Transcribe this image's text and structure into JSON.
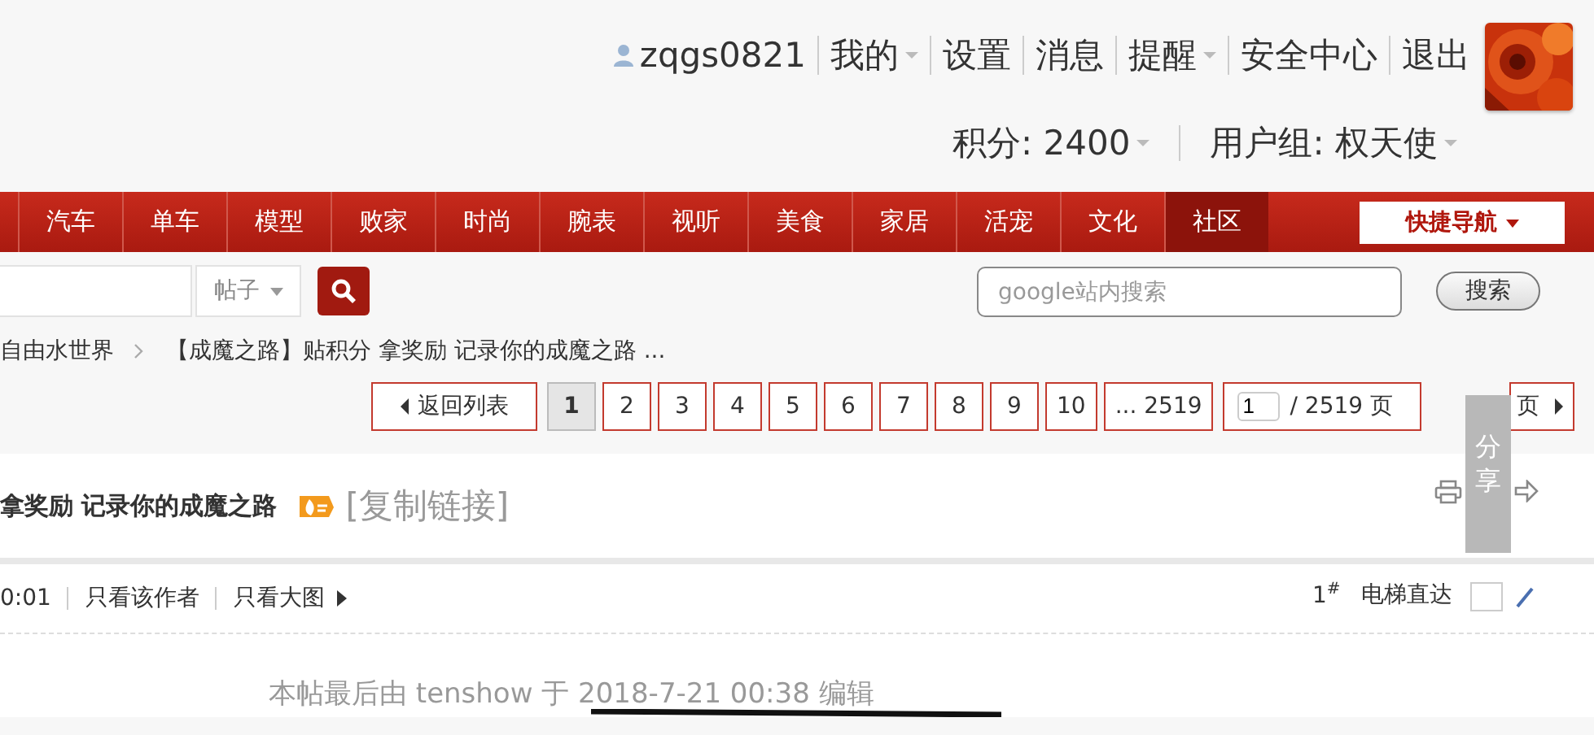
{
  "user_bar": {
    "username": "zqgs0821",
    "links": [
      {
        "label": "我的",
        "dropdown": true
      },
      {
        "label": "设置",
        "dropdown": false
      },
      {
        "label": "消息",
        "dropdown": false
      },
      {
        "label": "提醒",
        "dropdown": true
      },
      {
        "label": "安全中心",
        "dropdown": false
      },
      {
        "label": "退出",
        "dropdown": false
      }
    ],
    "points": "积分: 2400",
    "user_group": "用户组: 权天使"
  },
  "nav": {
    "items": [
      {
        "label": "汽车",
        "selected": false
      },
      {
        "label": "单车",
        "selected": false
      },
      {
        "label": "模型",
        "selected": false
      },
      {
        "label": "败家",
        "selected": false
      },
      {
        "label": "时尚",
        "selected": false
      },
      {
        "label": "腕表",
        "selected": false
      },
      {
        "label": "视听",
        "selected": false
      },
      {
        "label": "美食",
        "selected": false
      },
      {
        "label": "家居",
        "selected": false
      },
      {
        "label": "活宠",
        "selected": false
      },
      {
        "label": "文化",
        "selected": false
      },
      {
        "label": "社区",
        "selected": true
      }
    ],
    "quick_nav": "快捷导航"
  },
  "search": {
    "scope": "帖子",
    "site_search_placeholder": "google站内搜索",
    "site_search_button": "搜索"
  },
  "breadcrumb": [
    "自由水世界",
    "【成魔之路】贴积分 拿奖励 记录你的成魔之路 ..."
  ],
  "pager": {
    "back": "返回列表",
    "pages": [
      {
        "label": "1",
        "selected": true
      },
      {
        "label": "2",
        "selected": false
      },
      {
        "label": "3",
        "selected": false
      },
      {
        "label": "4",
        "selected": false
      },
      {
        "label": "5",
        "selected": false
      },
      {
        "label": "6",
        "selected": false
      },
      {
        "label": "7",
        "selected": false
      },
      {
        "label": "8",
        "selected": false
      },
      {
        "label": "9",
        "selected": false
      },
      {
        "label": "10",
        "selected": false
      },
      {
        "label": "... 2519",
        "selected": false
      }
    ],
    "page_input": "1",
    "total": "/ 2519 页",
    "next": "页"
  },
  "share_tab": "分享",
  "post": {
    "title": "拿奖励 记录你的成魔之路",
    "copy_link": "[复制链接]",
    "time": "0:01",
    "author_only": "只看该作者",
    "big_images": "只看大图",
    "floor": "1$^{#}$",
    "jump": "电梯直达",
    "edit_note": "本帖最后由 tenshow 于 2018-7-21 00:38 编辑"
  }
}
